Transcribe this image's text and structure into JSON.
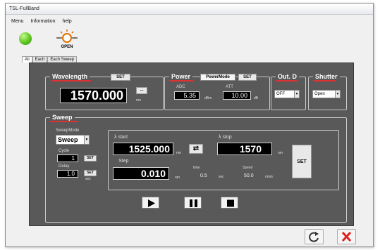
{
  "window": {
    "title": "TSL-FullBand"
  },
  "menu": {
    "items": [
      "Menu",
      "Information",
      "help"
    ]
  },
  "light": {
    "status": "OPEN"
  },
  "tabs": [
    "All",
    "Each",
    "Each Sweep"
  ],
  "wavelength": {
    "title": "Wavelength",
    "set_label": "SET",
    "value": "1570.000",
    "unit": "nm",
    "more_label": "..."
  },
  "power": {
    "title": "Power",
    "mode_label": "PowerMode",
    "set_label": "SET",
    "adc_label": "ADC",
    "adc_value": "5.35",
    "adc_unit": "dBm",
    "att_label": "ATT",
    "att_value": "10.00",
    "att_unit": "dB"
  },
  "out": {
    "title": "Out. D",
    "value": "OFF"
  },
  "shutter": {
    "title": "Shutter",
    "value": "Open"
  },
  "sweep": {
    "title": "Sweep",
    "mode_label": "SweepMode",
    "mode_value": "Sweep",
    "cycle_label": "Cycle",
    "cycle_value": "1",
    "cycle_set": "SET",
    "delay_label": "Delay",
    "delay_value": "1.0",
    "delay_set": "SET",
    "delay_unit": "sec",
    "start_label": "λ start",
    "start_value": "1525.000",
    "start_unit": "nm",
    "stop_label": "λ stop",
    "stop_value": "1570",
    "stop_unit": "nm",
    "step_label": "Step",
    "step_value": "0.010",
    "step_unit": "nm",
    "time_label": "time",
    "time_value": "0.5",
    "time_unit": "sec",
    "speed_label": "Speed",
    "speed_value": "50.0",
    "speed_unit": "nm/s",
    "set_label": "SET"
  },
  "colors": {
    "panel": "#595959",
    "accent_red": "#e03030",
    "led_green": "#6bd22a",
    "close_red": "#e02020"
  }
}
